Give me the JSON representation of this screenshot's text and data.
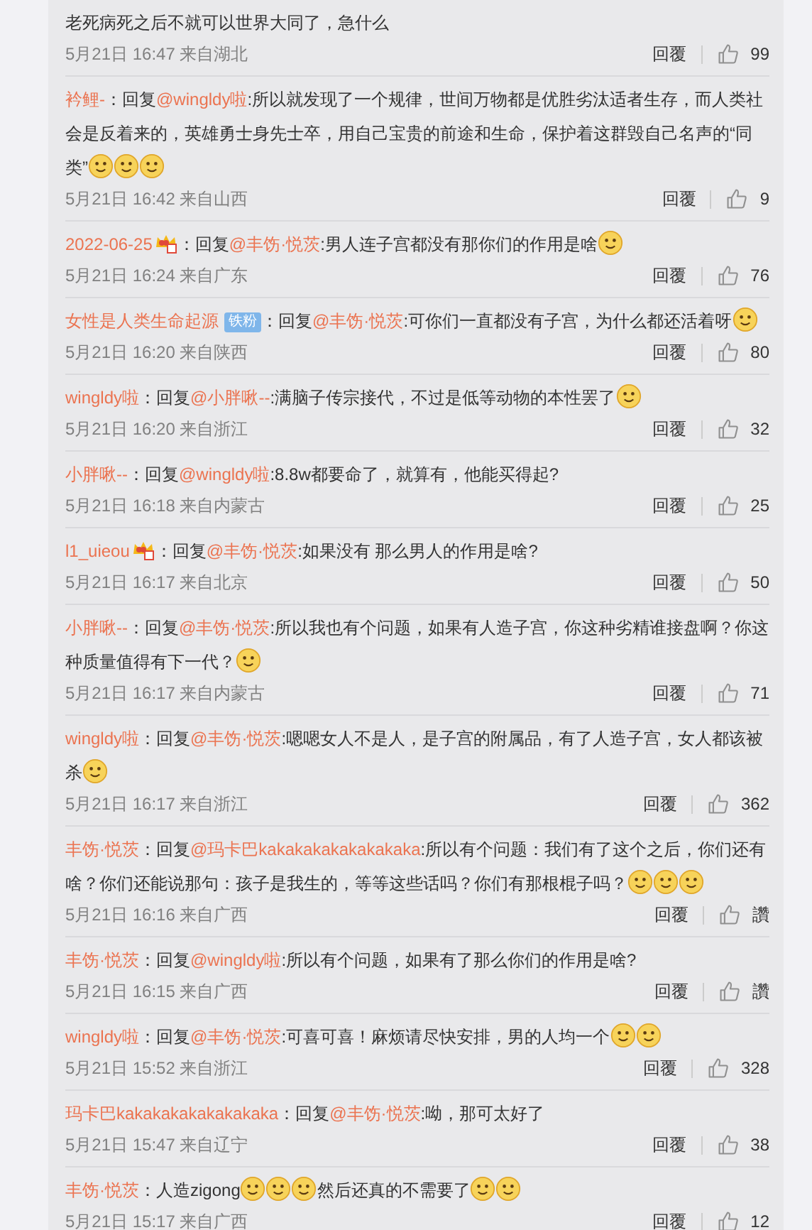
{
  "comments": [
    {
      "body": [
        {
          "kind": "text",
          "text": "老死病死之后不就可以世界大同了，急什么"
        }
      ],
      "time": "5月21日 16:47",
      "location": "来自湖北",
      "reply": "回覆",
      "likes": "99"
    },
    {
      "user": "衿鲤-",
      "body": [
        {
          "kind": "text",
          "text": "：回复"
        },
        {
          "kind": "mention",
          "text": "@wingldy啦"
        },
        {
          "kind": "text",
          "text": ":所以就发现了一个规律，世间万物都是优胜劣汰适者生存，而人类社会是反着来的，英雄勇士身先士卒，用自己宝贵的前途和生命，保护着这群毁自己名声的“同类”"
        },
        {
          "kind": "emoji"
        },
        {
          "kind": "emoji"
        },
        {
          "kind": "emoji"
        }
      ],
      "time": "5月21日 16:42",
      "location": "来自山西",
      "reply": "回覆",
      "likes": "9"
    },
    {
      "user": "2022-06-25",
      "badge": {
        "kind": "vip"
      },
      "body": [
        {
          "kind": "text",
          "text": "：回复"
        },
        {
          "kind": "mention",
          "text": "@丰饬·悦茨"
        },
        {
          "kind": "text",
          "text": ":男人连子宫都没有那你们的作用是啥"
        },
        {
          "kind": "emoji"
        }
      ],
      "time": "5月21日 16:24",
      "location": "来自广东",
      "reply": "回覆",
      "likes": "76"
    },
    {
      "user": "女性是人类生命起源",
      "badge": {
        "kind": "fan",
        "text": "铁粉"
      },
      "body": [
        {
          "kind": "text",
          "text": "：回复"
        },
        {
          "kind": "mention",
          "text": "@丰饬·悦茨"
        },
        {
          "kind": "text",
          "text": ":可你们一直都没有子宫，为什么都还活着呀"
        },
        {
          "kind": "emoji"
        }
      ],
      "time": "5月21日 16:20",
      "location": "来自陕西",
      "reply": "回覆",
      "likes": "80"
    },
    {
      "user": "wingldy啦",
      "body": [
        {
          "kind": "text",
          "text": "：回复"
        },
        {
          "kind": "mention",
          "text": "@小胖啾--"
        },
        {
          "kind": "text",
          "text": ":满脑子传宗接代，不过是低等动物的本性罢了"
        },
        {
          "kind": "emoji"
        }
      ],
      "time": "5月21日 16:20",
      "location": "来自浙江",
      "reply": "回覆",
      "likes": "32"
    },
    {
      "user": "小胖啾--",
      "body": [
        {
          "kind": "text",
          "text": "：回复"
        },
        {
          "kind": "mention",
          "text": "@wingldy啦"
        },
        {
          "kind": "text",
          "text": ":8.8w都要命了，就算有，他能买得起?"
        }
      ],
      "time": "5月21日 16:18",
      "location": "来自内蒙古",
      "reply": "回覆",
      "likes": "25"
    },
    {
      "user": "l1_uieou",
      "badge": {
        "kind": "vip"
      },
      "body": [
        {
          "kind": "text",
          "text": "：回复"
        },
        {
          "kind": "mention",
          "text": "@丰饬·悦茨"
        },
        {
          "kind": "text",
          "text": ":如果没有 那么男人的作用是啥?"
        }
      ],
      "time": "5月21日 16:17",
      "location": "来自北京",
      "reply": "回覆",
      "likes": "50"
    },
    {
      "user": "小胖啾--",
      "body": [
        {
          "kind": "text",
          "text": "：回复"
        },
        {
          "kind": "mention",
          "text": "@丰饬·悦茨"
        },
        {
          "kind": "text",
          "text": ":所以我也有个问题，如果有人造子宫，你这种劣精谁接盘啊？你这种质量值得有下一代？"
        },
        {
          "kind": "emoji"
        }
      ],
      "time": "5月21日 16:17",
      "location": "来自内蒙古",
      "reply": "回覆",
      "likes": "71"
    },
    {
      "user": "wingldy啦",
      "body": [
        {
          "kind": "text",
          "text": "：回复"
        },
        {
          "kind": "mention",
          "text": "@丰饬·悦茨"
        },
        {
          "kind": "text",
          "text": ":嗯嗯女人不是人，是子宫的附属品，有了人造子宫，女人都该被杀"
        },
        {
          "kind": "emoji"
        }
      ],
      "time": "5月21日 16:17",
      "location": "来自浙江",
      "reply": "回覆",
      "likes": "362"
    },
    {
      "user": "丰饬·悦茨",
      "body": [
        {
          "kind": "text",
          "text": "：回复"
        },
        {
          "kind": "mention",
          "text": "@玛卡巴kakakakakakakakaka"
        },
        {
          "kind": "text",
          "text": ":所以有个问题：我们有了这个之后，你们还有啥？你们还能说那句：孩子是我生的，等等这些话吗？你们有那根棍子吗？"
        },
        {
          "kind": "emoji"
        },
        {
          "kind": "emoji"
        },
        {
          "kind": "emoji"
        }
      ],
      "time": "5月21日 16:16",
      "location": "来自广西",
      "reply": "回覆",
      "likes": "讚"
    },
    {
      "user": "丰饬·悦茨",
      "body": [
        {
          "kind": "text",
          "text": "：回复"
        },
        {
          "kind": "mention",
          "text": "@wingldy啦"
        },
        {
          "kind": "text",
          "text": ":所以有个问题，如果有了那么你们的作用是啥?"
        }
      ],
      "time": "5月21日 16:15",
      "location": "来自广西",
      "reply": "回覆",
      "likes": "讚"
    },
    {
      "user": "wingldy啦",
      "body": [
        {
          "kind": "text",
          "text": "：回复"
        },
        {
          "kind": "mention",
          "text": "@丰饬·悦茨"
        },
        {
          "kind": "text",
          "text": ":可喜可喜！麻烦请尽快安排，男的人均一个"
        },
        {
          "kind": "emoji"
        },
        {
          "kind": "emoji"
        }
      ],
      "time": "5月21日 15:52",
      "location": "来自浙江",
      "reply": "回覆",
      "likes": "328"
    },
    {
      "user": "玛卡巴kakakakakakakakaka",
      "body": [
        {
          "kind": "text",
          "text": "：回复"
        },
        {
          "kind": "mention",
          "text": "@丰饬·悦茨"
        },
        {
          "kind": "text",
          "text": ":呦，那可太好了"
        }
      ],
      "time": "5月21日 15:47",
      "location": "来自辽宁",
      "reply": "回覆",
      "likes": "38"
    },
    {
      "user": "丰饬·悦茨",
      "body": [
        {
          "kind": "text",
          "text": "：人造zigong"
        },
        {
          "kind": "emoji"
        },
        {
          "kind": "emoji"
        },
        {
          "kind": "emoji"
        },
        {
          "kind": "text",
          "text": "然后还真的不需要了"
        },
        {
          "kind": "emoji"
        },
        {
          "kind": "emoji"
        }
      ],
      "time": "5月21日 15:17",
      "location": "来自广西",
      "reply": "回覆",
      "likes": "12"
    }
  ]
}
